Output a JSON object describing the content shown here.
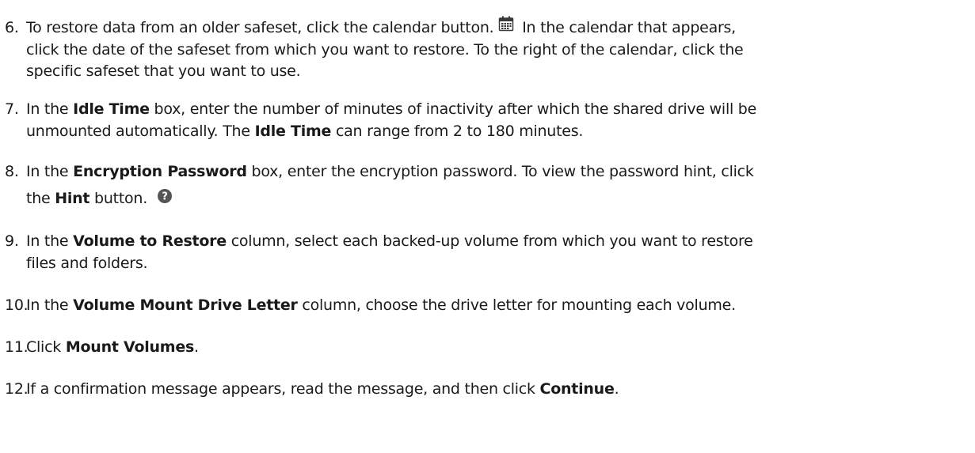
{
  "steps": [
    {
      "number": "6.",
      "lines": [
        {
          "before": "To restore data from an older safeset, click the calendar button.",
          "icon": "calendar-icon",
          "after": " In the calendar that appears,"
        },
        {
          "text": "click the date of the safeset from which you want to restore. To the right of the calendar, click the"
        },
        {
          "text": "specific safeset that you want to use."
        }
      ]
    },
    {
      "number": "7.",
      "lines": [
        {
          "t1": "In the ",
          "b1": "Idle Time",
          "t2": " box, enter the number of minutes of inactivity after which the shared drive will be"
        },
        {
          "t1": "unmounted automatically. The ",
          "b1": "Idle Time",
          "t2": " can range from 2 to 180 minutes."
        }
      ]
    },
    {
      "number": "8.",
      "lines": [
        {
          "t1": "In the ",
          "b1": "Encryption Password",
          "t2": " box, enter the encryption password. To view the password hint, click"
        },
        {
          "t1": "the ",
          "b1": "Hint",
          "t2": " button.",
          "icon": "help-icon"
        }
      ]
    },
    {
      "number": "9.",
      "lines": [
        {
          "t1": "In the ",
          "b1": "Volume to Restore",
          "t2": " column, select each backed-up volume from which you want to restore"
        },
        {
          "text": "files and folders."
        }
      ]
    },
    {
      "number": "10.",
      "lines": [
        {
          "t1": "In the ",
          "b1": "Volume Mount Drive Letter",
          "t2": " column, choose the drive letter for mounting each volume."
        }
      ]
    },
    {
      "number": "11.",
      "lines": [
        {
          "t1": "Click ",
          "b1": "Mount Volumes",
          "t2": "."
        }
      ]
    },
    {
      "number": "12.",
      "lines": [
        {
          "t1": "If a confirmation message appears, read the message, and then click ",
          "b1": "Continue",
          "t2": "."
        }
      ]
    }
  ],
  "colors": {
    "text": "#1a1a1a",
    "calendar_icon": "#3a3a3a",
    "help_icon_bg": "#555555"
  }
}
